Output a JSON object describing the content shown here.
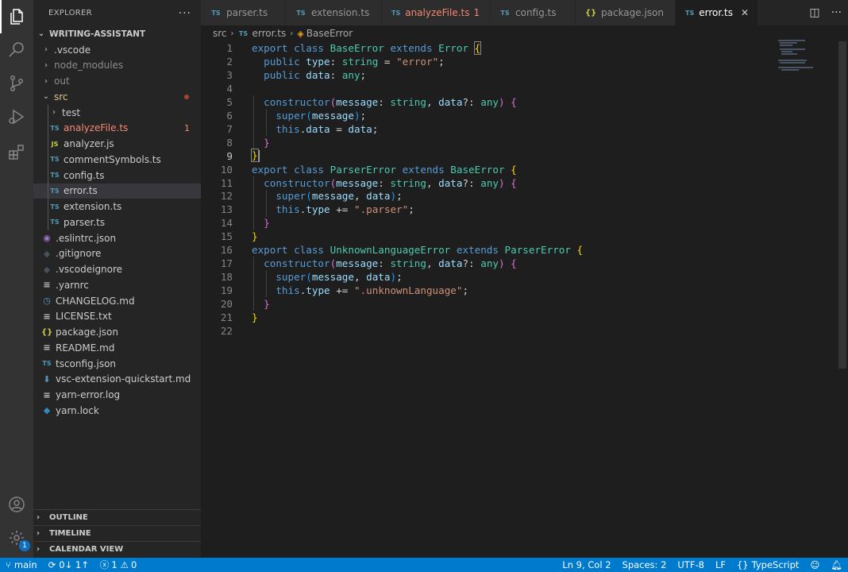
{
  "sidebar": {
    "title": "EXPLORER",
    "more_label": "···",
    "root": "WRITING-ASSISTANT",
    "items": [
      {
        "label": ".vscode",
        "kind": "folder",
        "collapsed": true
      },
      {
        "label": "node_modules",
        "kind": "folder",
        "collapsed": true,
        "dim": true
      },
      {
        "label": "out",
        "kind": "folder",
        "collapsed": true,
        "dim": true
      },
      {
        "label": "src",
        "kind": "folder",
        "collapsed": false,
        "modified": true
      },
      {
        "label": "test",
        "kind": "folder",
        "collapsed": true
      },
      {
        "label": "analyzeFile.ts",
        "kind": "ts",
        "badge": "1",
        "error": true
      },
      {
        "label": "analyzer.js",
        "kind": "js"
      },
      {
        "label": "commentSymbols.ts",
        "kind": "ts"
      },
      {
        "label": "config.ts",
        "kind": "ts"
      },
      {
        "label": "error.ts",
        "kind": "ts",
        "selected": true
      },
      {
        "label": "extension.ts",
        "kind": "ts"
      },
      {
        "label": "parser.ts",
        "kind": "ts"
      },
      {
        "label": ".eslintrc.json",
        "kind": "eslint"
      },
      {
        "label": ".gitignore",
        "kind": "git"
      },
      {
        "label": ".vscodeignore",
        "kind": "vscode"
      },
      {
        "label": ".yarnrc",
        "kind": "text"
      },
      {
        "label": "CHANGELOG.md",
        "kind": "md"
      },
      {
        "label": "LICENSE.txt",
        "kind": "text"
      },
      {
        "label": "package.json",
        "kind": "json"
      },
      {
        "label": "README.md",
        "kind": "text"
      },
      {
        "label": "tsconfig.json",
        "kind": "tsconfig"
      },
      {
        "label": "vsc-extension-quickstart.md",
        "kind": "download"
      },
      {
        "label": "yarn-error.log",
        "kind": "text"
      },
      {
        "label": "yarn.lock",
        "kind": "yarn"
      }
    ],
    "sections": [
      "OUTLINE",
      "TIMELINE",
      "CALENDAR VIEW"
    ]
  },
  "tabs": [
    {
      "label": "parser.ts",
      "icon": "TS"
    },
    {
      "label": "extension.ts",
      "icon": "TS"
    },
    {
      "label": "analyzeFile.ts",
      "icon": "TS",
      "badge": "1",
      "error": true
    },
    {
      "label": "config.ts",
      "icon": "TS"
    },
    {
      "label": "package.json",
      "icon": "{}"
    },
    {
      "label": "error.ts",
      "icon": "TS",
      "active": true
    }
  ],
  "breadcrumb": {
    "folder": "src",
    "file": "error.ts",
    "symbol": "BaseError"
  },
  "editor": {
    "line_numbers": [
      "1",
      "2",
      "3",
      "4",
      "5",
      "6",
      "7",
      "8",
      "9",
      "10",
      "11",
      "12",
      "13",
      "14",
      "15",
      "16",
      "17",
      "18",
      "19",
      "20",
      "21",
      "22"
    ],
    "current_line": 9
  },
  "status": {
    "branch": "main",
    "sync": "0↓ 1↑",
    "errors": "1",
    "warnings": "0",
    "position": "Ln 9, Col 2",
    "spaces": "Spaces: 2",
    "encoding": "UTF-8",
    "eol": "LF",
    "language": "TypeScript"
  },
  "activity_bar": {
    "icons": [
      "files-icon",
      "search-icon",
      "source-control-icon",
      "run-debug-icon",
      "extensions-icon",
      "account-icon",
      "settings-icon"
    ],
    "settings_badge": "1"
  },
  "colors": {
    "accent": "#007acc",
    "error": "#f48771",
    "selection": "#37373d"
  }
}
